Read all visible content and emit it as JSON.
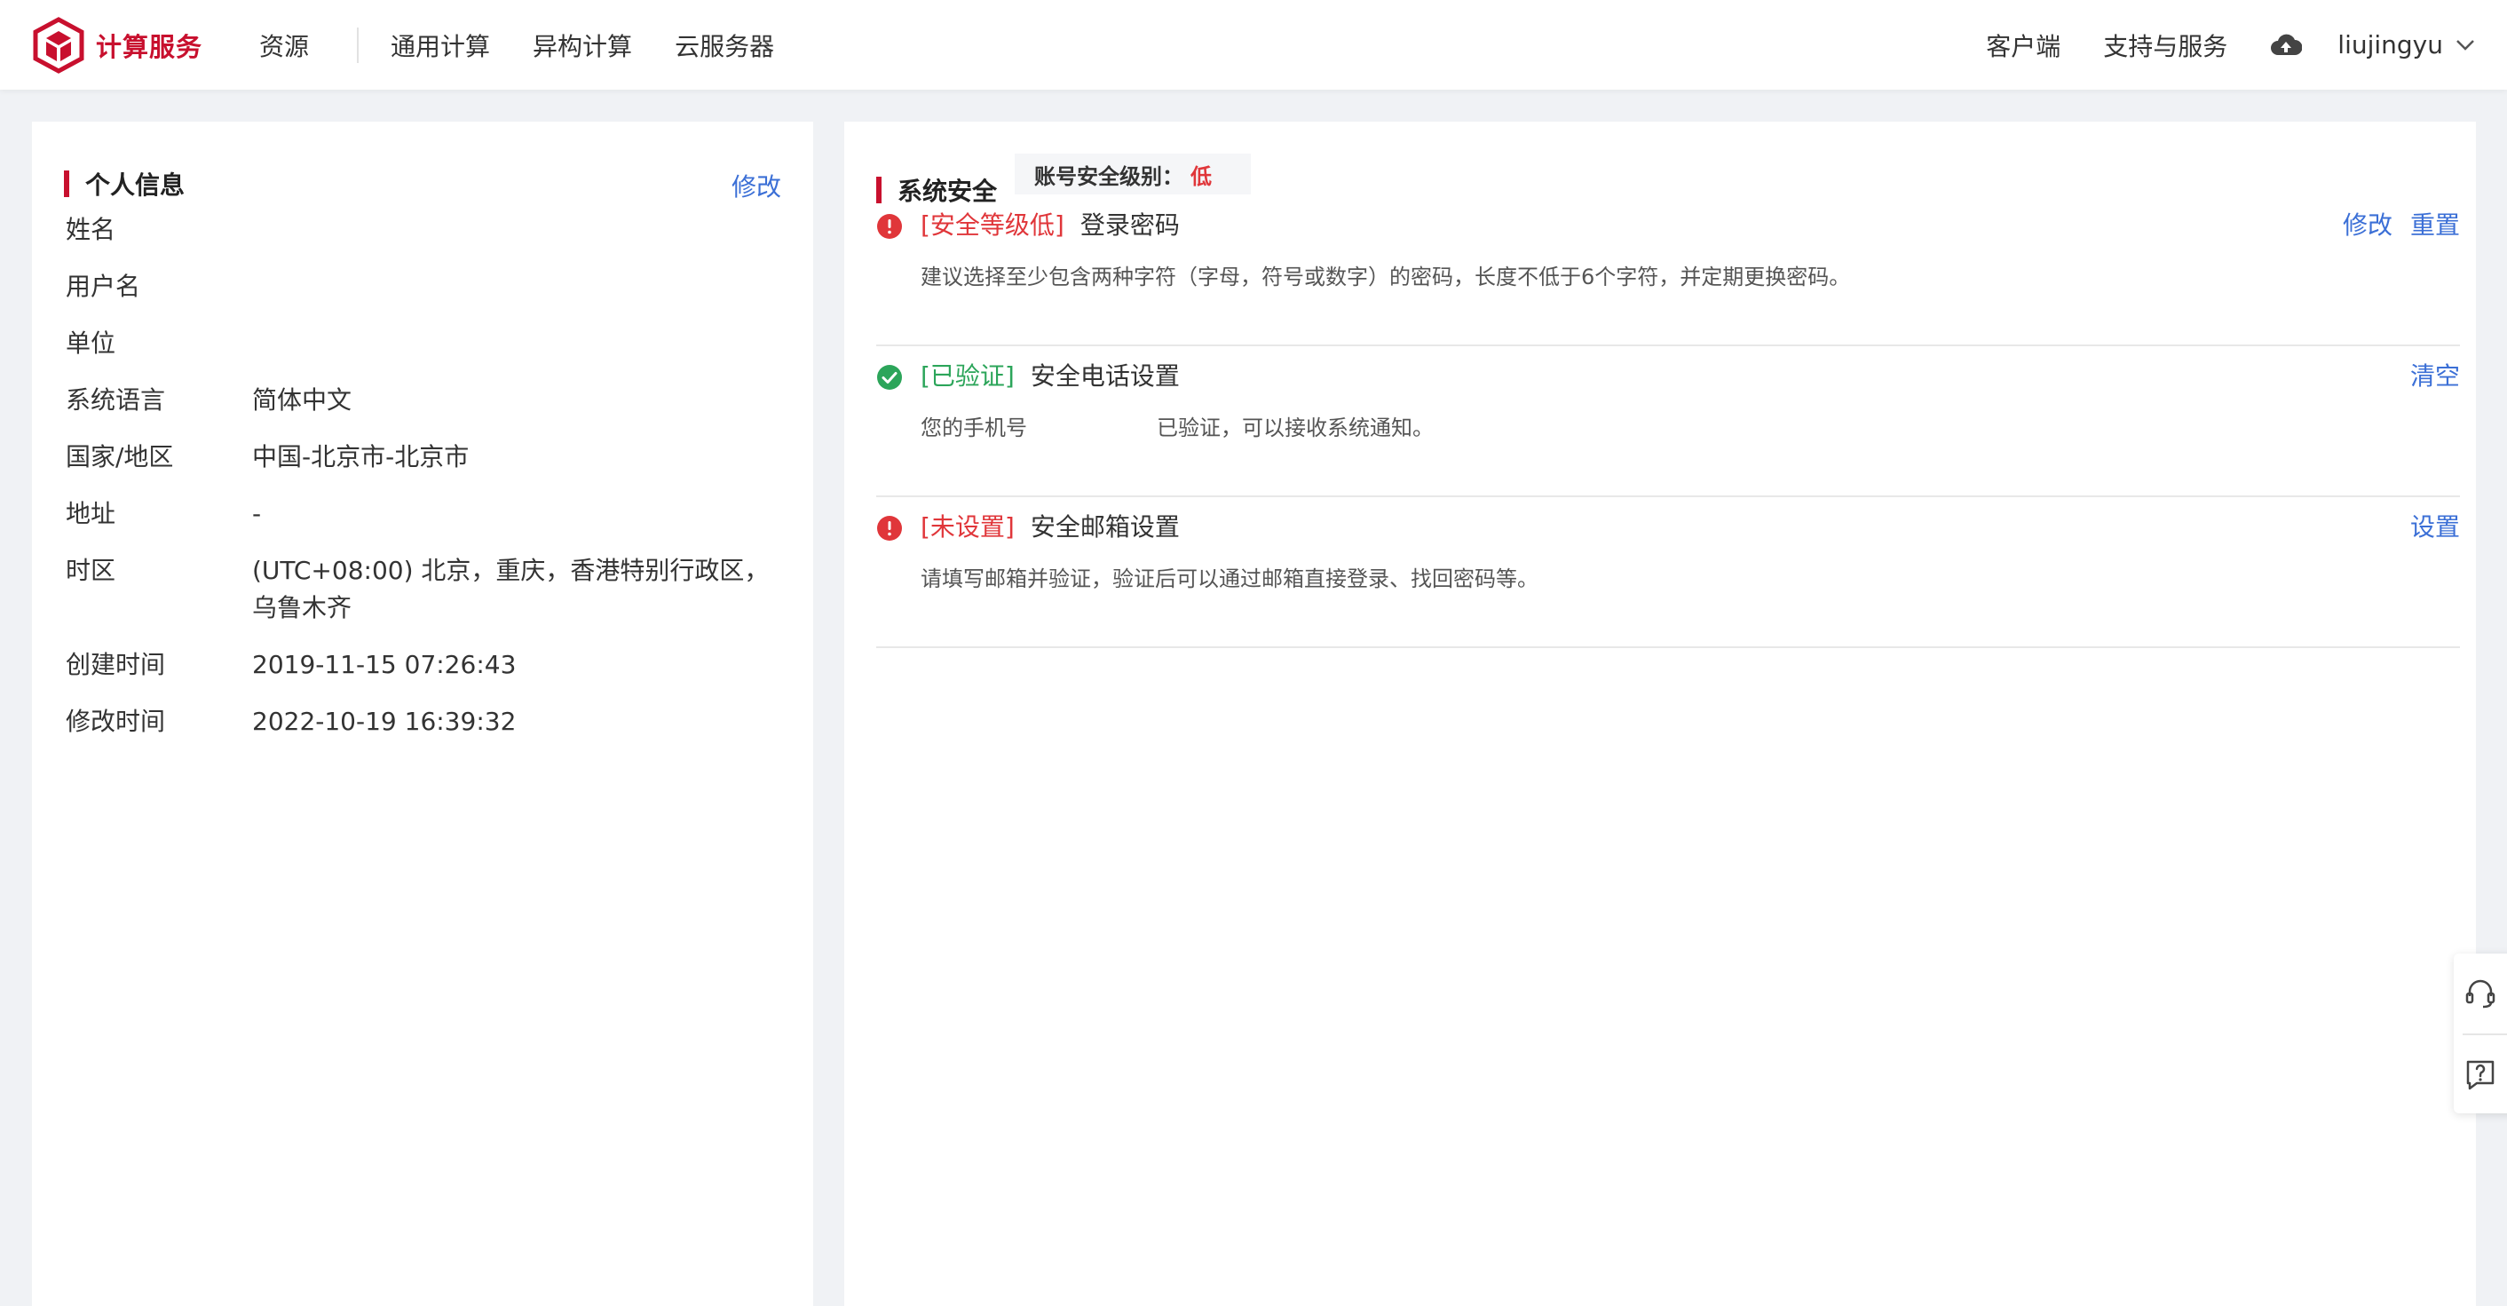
{
  "header": {
    "logo_text": "计算服务",
    "nav": {
      "resource": "资源",
      "general": "通用计算",
      "hetero": "异构计算",
      "cloud": "云服务器"
    },
    "client": "客户端",
    "support": "支持与服务",
    "username": "liujingyu"
  },
  "personal": {
    "title": "个人信息",
    "edit": "修改",
    "rows": [
      {
        "label": "姓名",
        "value": ""
      },
      {
        "label": "用户名",
        "value": ""
      },
      {
        "label": "单位",
        "value": ""
      },
      {
        "label": "系统语言",
        "value": "简体中文"
      },
      {
        "label": "国家/地区",
        "value": "中国-北京市-北京市"
      },
      {
        "label": "地址",
        "value": "-"
      },
      {
        "label": "时区",
        "value": "(UTC+08:00) 北京，重庆，香港特别行政区，乌鲁木齐"
      },
      {
        "label": "创建时间",
        "value": "2019-11-15 07:26:43"
      },
      {
        "label": "修改时间",
        "value": "2022-10-19 16:39:32"
      }
    ]
  },
  "security": {
    "title": "系统安全",
    "level_label": "账号安全级别：",
    "level_value": "低",
    "items": [
      {
        "tag": "[安全等级低]",
        "name": "登录密码",
        "desc": "建议选择至少包含两种字符（字母，符号或数字）的密码，长度不低于6个字符，并定期更换密码。",
        "actions": [
          "修改",
          "重置"
        ]
      },
      {
        "tag": "[已验证]",
        "name": "安全电话设置",
        "desc_before": "您的手机号",
        "desc_after": "已验证，可以接收系统通知。",
        "actions": [
          "清空"
        ]
      },
      {
        "tag": "[未设置]",
        "name": "安全邮箱设置",
        "desc": "请填写邮箱并验证，验证后可以通过邮箱直接登录、找回密码等。",
        "actions": [
          "设置"
        ]
      }
    ]
  },
  "colors": {
    "brand_red": "#c8102e",
    "link_blue": "#3b6fd6",
    "warn_red": "#e0363a",
    "ok_green": "#2ca55a"
  }
}
